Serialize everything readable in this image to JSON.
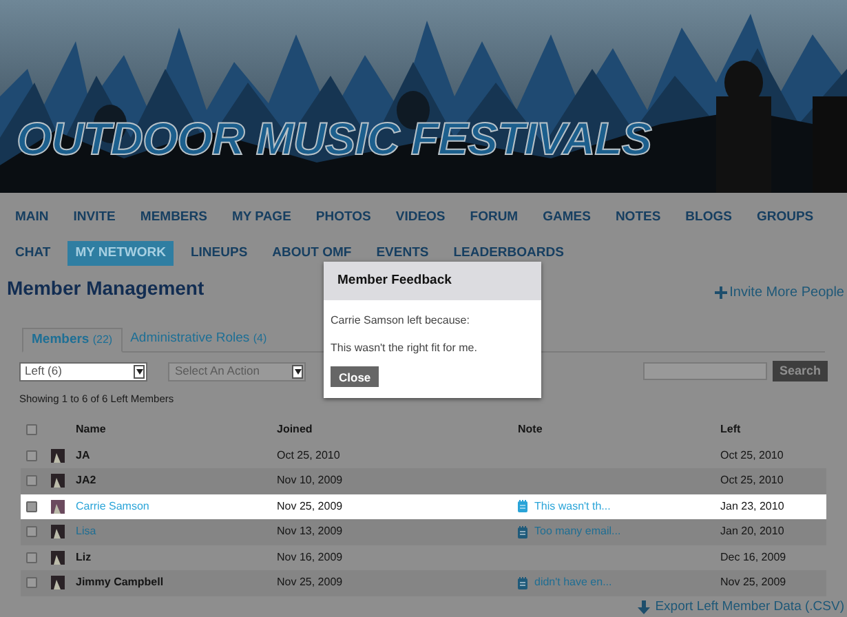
{
  "banner": {
    "title": "OUTDOOR MUSIC FESTIVALS"
  },
  "nav": [
    {
      "label": "MAIN",
      "selected": false
    },
    {
      "label": "INVITE",
      "selected": false
    },
    {
      "label": "MEMBERS",
      "selected": false
    },
    {
      "label": "MY PAGE",
      "selected": false
    },
    {
      "label": "PHOTOS",
      "selected": false
    },
    {
      "label": "VIDEOS",
      "selected": false
    },
    {
      "label": "FORUM",
      "selected": false
    },
    {
      "label": "GAMES",
      "selected": false
    },
    {
      "label": "NOTES",
      "selected": false
    },
    {
      "label": "BLOGS",
      "selected": false
    },
    {
      "label": "GROUPS",
      "selected": false
    },
    {
      "label": "CHAT",
      "selected": false
    },
    {
      "label": "MY NETWORK",
      "selected": true
    },
    {
      "label": "LINEUPS",
      "selected": false
    },
    {
      "label": "ABOUT OMF",
      "selected": false
    },
    {
      "label": "EVENTS",
      "selected": false
    },
    {
      "label": "LEADERBOARDS",
      "selected": false
    }
  ],
  "heading": "Member Management",
  "invite_link": "Invite More People",
  "tabs": [
    {
      "label": "Members",
      "count": "(22)",
      "selected": true
    },
    {
      "label": "Administrative Roles",
      "count": "(4)",
      "selected": false
    }
  ],
  "filter": {
    "value": "Left (6)"
  },
  "action": {
    "value": "Select An Action"
  },
  "search": {
    "button": "Search"
  },
  "summary": "Showing 1 to 6 of 6 Left Members",
  "table": {
    "columns": [
      "Name",
      "Joined",
      "Note",
      "Left"
    ],
    "select_all_checked": false,
    "rows": [
      {
        "name": "JA",
        "linked": false,
        "joined": "Oct 25, 2010",
        "note": "",
        "left": "Oct 25, 2010",
        "selected": false,
        "checked": false
      },
      {
        "name": "JA2",
        "linked": false,
        "joined": "Nov 10, 2009",
        "note": "",
        "left": "Oct 25, 2010",
        "selected": false,
        "checked": false
      },
      {
        "name": "Carrie Samson",
        "linked": true,
        "joined": "Nov 25, 2009",
        "note": "This wasn't th...",
        "left": "Jan 23, 2010",
        "selected": true,
        "checked": false
      },
      {
        "name": "Lisa",
        "linked": true,
        "joined": "Nov 13, 2009",
        "note": "Too many email...",
        "left": "Jan 20, 2010",
        "selected": false,
        "checked": false
      },
      {
        "name": "Liz",
        "linked": false,
        "joined": "Nov 16, 2009",
        "note": "",
        "left": "Dec 16, 2009",
        "selected": false,
        "checked": false
      },
      {
        "name": "Jimmy Campbell",
        "linked": false,
        "joined": "Nov 25, 2009",
        "note": "didn't have en...",
        "left": "Nov 25, 2009",
        "selected": false,
        "checked": false
      }
    ]
  },
  "export_link": "Export Left Member Data (.CSV)",
  "dialog": {
    "title": "Member Feedback",
    "message": "Carrie Samson left because:",
    "reason": "This wasn't the right fit for me.",
    "button": "Close"
  }
}
